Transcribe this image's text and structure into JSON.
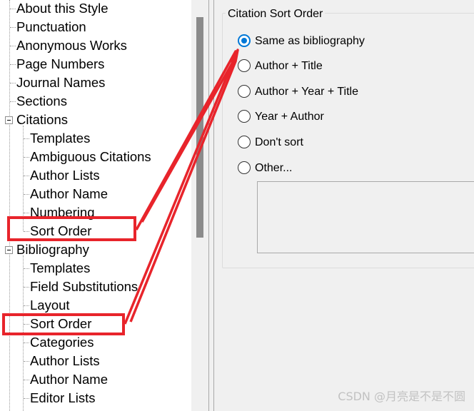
{
  "tree": {
    "items": [
      {
        "label": "About this Style",
        "level": 1
      },
      {
        "label": "Punctuation",
        "level": 1
      },
      {
        "label": "Anonymous Works",
        "level": 1
      },
      {
        "label": "Page Numbers",
        "level": 1
      },
      {
        "label": "Journal Names",
        "level": 1
      },
      {
        "label": "Sections",
        "level": 1
      },
      {
        "label": "Citations",
        "level": 0,
        "expanded": true
      },
      {
        "label": "Templates",
        "level": 2
      },
      {
        "label": "Ambiguous Citations",
        "level": 2
      },
      {
        "label": "Author Lists",
        "level": 2
      },
      {
        "label": "Author Name",
        "level": 2
      },
      {
        "label": "Numbering",
        "level": 2
      },
      {
        "label": "Sort Order",
        "level": 2
      },
      {
        "label": "Bibliography",
        "level": 0,
        "expanded": true
      },
      {
        "label": "Templates",
        "level": 2
      },
      {
        "label": "Field Substitutions",
        "level": 2
      },
      {
        "label": "Layout",
        "level": 2
      },
      {
        "label": "Sort Order",
        "level": 2
      },
      {
        "label": "Categories",
        "level": 2
      },
      {
        "label": "Author Lists",
        "level": 2
      },
      {
        "label": "Author Name",
        "level": 2
      },
      {
        "label": "Editor Lists",
        "level": 2
      }
    ]
  },
  "panel": {
    "title": "Citation Sort Order",
    "options": [
      {
        "label": "Same as bibliography",
        "checked": true
      },
      {
        "label": "Author + Title",
        "checked": false
      },
      {
        "label": "Author + Year + Title",
        "checked": false
      },
      {
        "label": "Year + Author",
        "checked": false
      },
      {
        "label": "Don't sort",
        "checked": false
      },
      {
        "label": "Other...",
        "checked": false
      }
    ]
  },
  "annotation": {
    "color": "#e8242b"
  },
  "watermark": "CSDN @月亮是不是不圆"
}
